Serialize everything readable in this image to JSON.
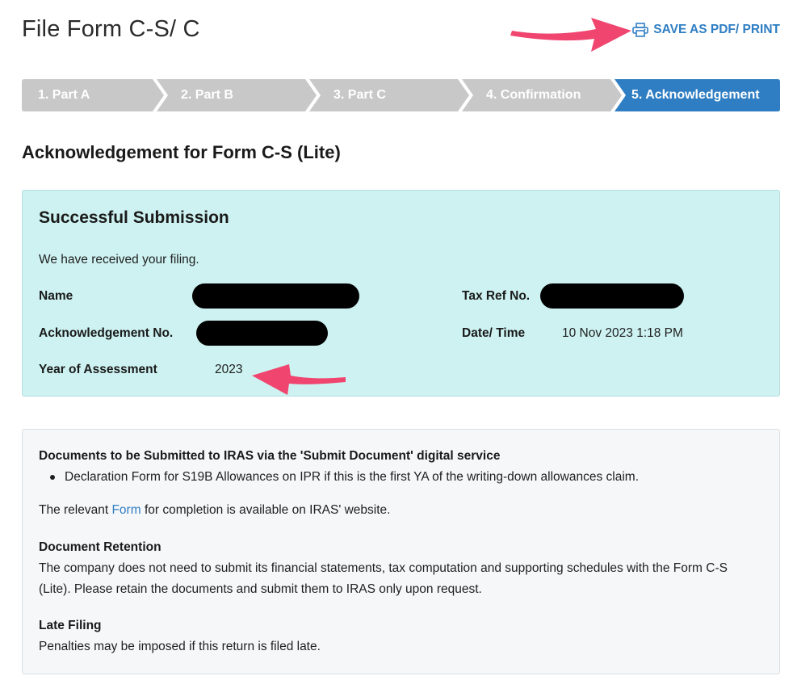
{
  "page": {
    "title": "File Form C-S/ C"
  },
  "toolbar": {
    "print_label": "SAVE AS PDF/ PRINT",
    "print_icon": "printer-icon"
  },
  "stepper": {
    "steps": [
      {
        "label": "1.  Part A",
        "state": "done"
      },
      {
        "label": "2.  Part B",
        "state": "done"
      },
      {
        "label": "3.  Part C",
        "state": "done"
      },
      {
        "label": "4.  Confirmation",
        "state": "done"
      },
      {
        "label": "5.  Acknowledgement",
        "state": "active"
      }
    ],
    "colors": {
      "inactive": "#c8c8c8",
      "active": "#2f7ec3"
    }
  },
  "main": {
    "section_title": "Acknowledgement for Form C-S (Lite)",
    "success": {
      "heading": "Successful Submission",
      "message": "We have received your filing.",
      "name_label": "Name",
      "ack_label": "Acknowledgement No.",
      "ya_label": "Year of Assessment",
      "ya_value": "2023",
      "taxref_label": "Tax Ref No.",
      "datetime_label": "Date/ Time",
      "datetime_value": "10 Nov 2023 1:18 PM",
      "background": "#cdf2f1"
    },
    "info": {
      "docs_heading": "Documents to be Submitted to IRAS via the 'Submit Document' digital service",
      "docs_items": [
        "Declaration Form for S19B Allowances on IPR if this is the first YA of the writing-down allowances claim."
      ],
      "relevant_prefix": "The relevant ",
      "relevant_link": "Form",
      "relevant_suffix": " for completion is available on IRAS' website.",
      "retention_heading": "Document Retention",
      "retention_text": "The company does not need to submit its financial statements, tax computation and supporting schedules with the Form C-S (Lite). Please retain the documents and submit them to IRAS only upon request.",
      "late_heading": "Late Filing",
      "late_text": "Penalties may be imposed if this return is filed late."
    }
  },
  "annotations": {
    "arrow_color": "#f0456f"
  }
}
